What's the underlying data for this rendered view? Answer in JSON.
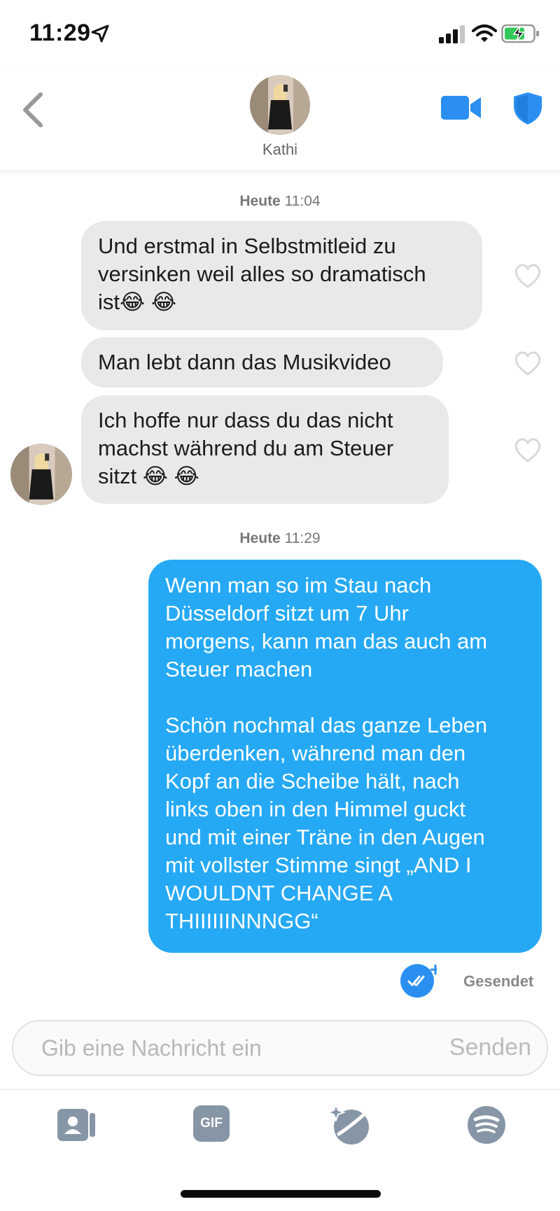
{
  "status_bar": {
    "time": "11:29"
  },
  "header": {
    "contact_name": "Kathi"
  },
  "messages": [
    {
      "timestamp_prefix": "Heute",
      "timestamp_time": "11:04"
    },
    {
      "text": "Und erstmal in Selbstmitleid zu\nversinken weil alles so dramatisch\nist😂 😂"
    },
    {
      "text": "Man lebt dann das Musikvideo"
    },
    {
      "text": "Ich hoffe nur dass du das nicht\nmachst während du am Steuer\nsitzt 😂 😂"
    },
    {
      "timestamp_prefix": "Heute",
      "timestamp_time": "11:29"
    },
    {
      "text": "Wenn man so im Stau nach\nDüsseldorf sitzt um 7 Uhr\nmorgens, kann man das auch am\nSteuer machen\n\nSchön nochmal das ganze Leben\nüberdenken, während man den\nKopf an die Scheibe hält, nach\nlinks oben in den Himmel guckt\nund mit einer Träne in den Augen\nmit vollster Stimme singt „AND I\nWOULDNT CHANGE A\nTHIIIIIINNNGG“"
    }
  ],
  "sent_status": "Gesendet",
  "composer": {
    "placeholder": "Gib eine Nachricht ein",
    "send_label": "Senden"
  },
  "toolbar": {
    "gif_label": "GIF"
  },
  "colors": {
    "accent": "#26a9f5",
    "icon_blue": "#2a8ff0",
    "incoming_bubble": "#e9e9eb",
    "tool_gray": "#8796a6"
  },
  "icons": [
    "location-arrow-icon",
    "signal-icon",
    "wifi-icon",
    "battery-charging-icon",
    "back-chevron-icon",
    "video-call-icon",
    "shield-icon",
    "heart-icon",
    "double-check-icon",
    "contact-card-icon",
    "gif-icon",
    "sparkle-badge-icon",
    "spotify-icon"
  ]
}
